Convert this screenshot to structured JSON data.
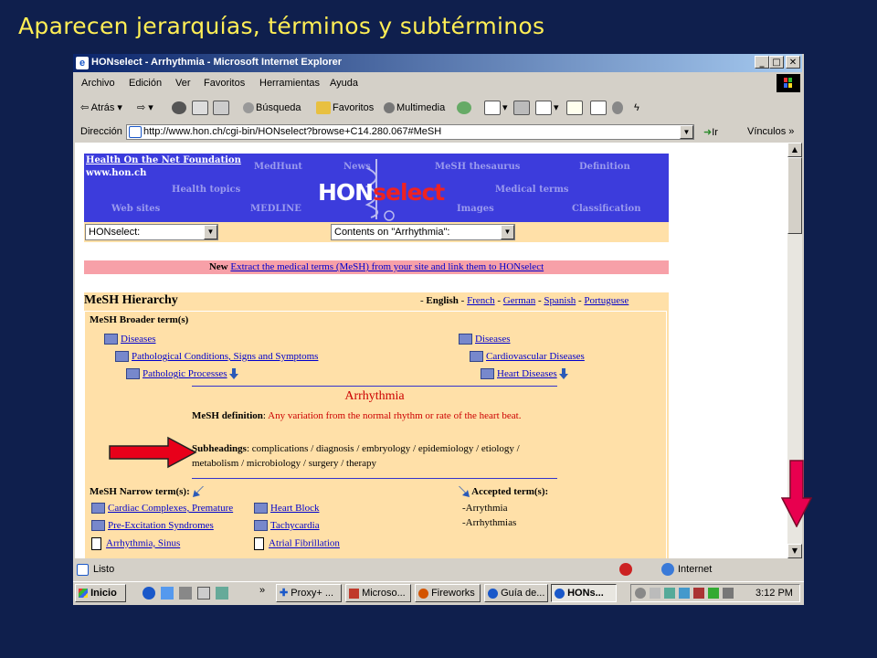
{
  "slide": {
    "title": "Aparecen jerarquías, términos y subtérminos"
  },
  "window": {
    "title": "HONselect - Arrhythmia - Microsoft Internet Explorer"
  },
  "menu": [
    "Archivo",
    "Edición",
    "Ver",
    "Favoritos",
    "Herramientas",
    "Ayuda"
  ],
  "toolbar": {
    "back": "Atrás",
    "search": "Búsqueda",
    "favorites": "Favoritos",
    "multimedia": "Multimedia"
  },
  "address": {
    "label": "Dirección",
    "url": "http://www.hon.ch/cgi-bin/HONselect?browse+C14.280.067#MeSH",
    "go": "Ir",
    "links": "Vínculos"
  },
  "hon_header": {
    "foundation": "Health On the Net Foundation",
    "site": "www.hon.ch",
    "logo_hon": "HON",
    "logo_select": "select",
    "links": [
      "MedHunt",
      "News",
      "MeSH thesaurus",
      "Definition",
      "Health topics",
      "Medical terms",
      "Web sites",
      "MEDLINE",
      "Images",
      "Classification"
    ],
    "combo1": "HONselect:",
    "combo2": "Contents on \"Arrhythmia\":"
  },
  "banner": {
    "new": "New",
    "text": "Extract the medical terms (MeSH) from your site and link them to HONselect"
  },
  "hierarchy": {
    "title": "MeSH Hierarchy",
    "lang_sep": "-",
    "lang_current": "English",
    "languages": [
      "French",
      "German",
      "Spanish",
      "Portuguese"
    ],
    "broader_label": "MeSH Broader term(s)",
    "left_tree": [
      "Diseases",
      "Pathological Conditions, Signs and Symptoms",
      "Pathologic Processes"
    ],
    "right_tree": [
      "Diseases",
      "Cardiovascular Diseases",
      "Heart Diseases"
    ],
    "term": "Arrhythmia",
    "definition_label": "MeSH definition",
    "definition_text": "Any variation from the normal rhythm or rate of the heart beat.",
    "subheadings_label": "Subheadings",
    "subheadings_text": "complications / diagnosis / embryology / epidemiology / etiology / metabolism / microbiology / surgery / therapy",
    "narrow_label": "MeSH Narrow term(s)",
    "narrow_col1": [
      "Cardiac Complexes, Premature",
      "Pre-Excitation Syndromes",
      "Arrhythmia, Sinus"
    ],
    "narrow_col2": [
      "Heart Block",
      "Tachycardia",
      "Atrial Fibrillation"
    ],
    "accepted_label": "Accepted term(s)",
    "accepted": [
      "-Arrythmia",
      "-Arrhythmias"
    ]
  },
  "status": {
    "text": "Listo",
    "zone": "Internet"
  },
  "taskbar": {
    "start": "Inicio",
    "buttons": [
      "Proxy+ ...",
      "Microso...",
      "Fireworks",
      "Guía de...",
      "HONs..."
    ],
    "clock": "3:12 PM"
  },
  "colors": {
    "slide_bg": "#0f1f4d",
    "title": "#ffee55",
    "hon_blue": "#3c3cdc",
    "panel": "#ffe0a8",
    "red_arrow": "#e8001a",
    "pink_arrow": "#e8004f"
  }
}
